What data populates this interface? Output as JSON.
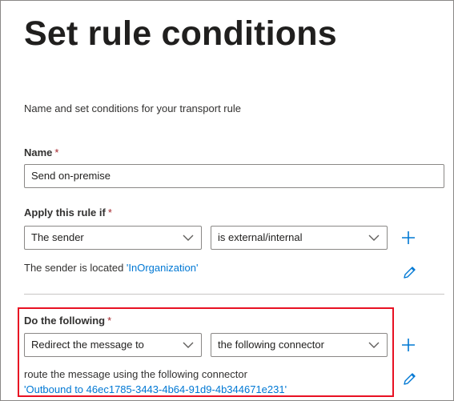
{
  "page": {
    "title": "Set rule conditions",
    "subtitle": "Name and set conditions for your transport rule"
  },
  "name_section": {
    "label": "Name",
    "required_mark": "*",
    "value": "Send on-premise"
  },
  "apply_section": {
    "label": "Apply this rule if",
    "required_mark": "*",
    "condition_dropdown": "The sender",
    "operator_dropdown": "is external/internal",
    "description_prefix": "The sender is located ",
    "description_link": "'InOrganization'"
  },
  "action_section": {
    "label": "Do the following",
    "required_mark": "*",
    "action_dropdown": "Redirect the message to",
    "target_dropdown": "the following connector",
    "description_line1": "route the message using the following connector",
    "description_link": "'Outbound to 46ec1785-3443-4b64-91d9-4b344671e231'"
  },
  "colors": {
    "accent": "#0078d4",
    "required": "#a4262c",
    "highlight_box": "#e81123"
  },
  "icons": {
    "add": "plus-icon",
    "edit": "pencil-icon",
    "dropdown": "chevron-down-icon"
  }
}
